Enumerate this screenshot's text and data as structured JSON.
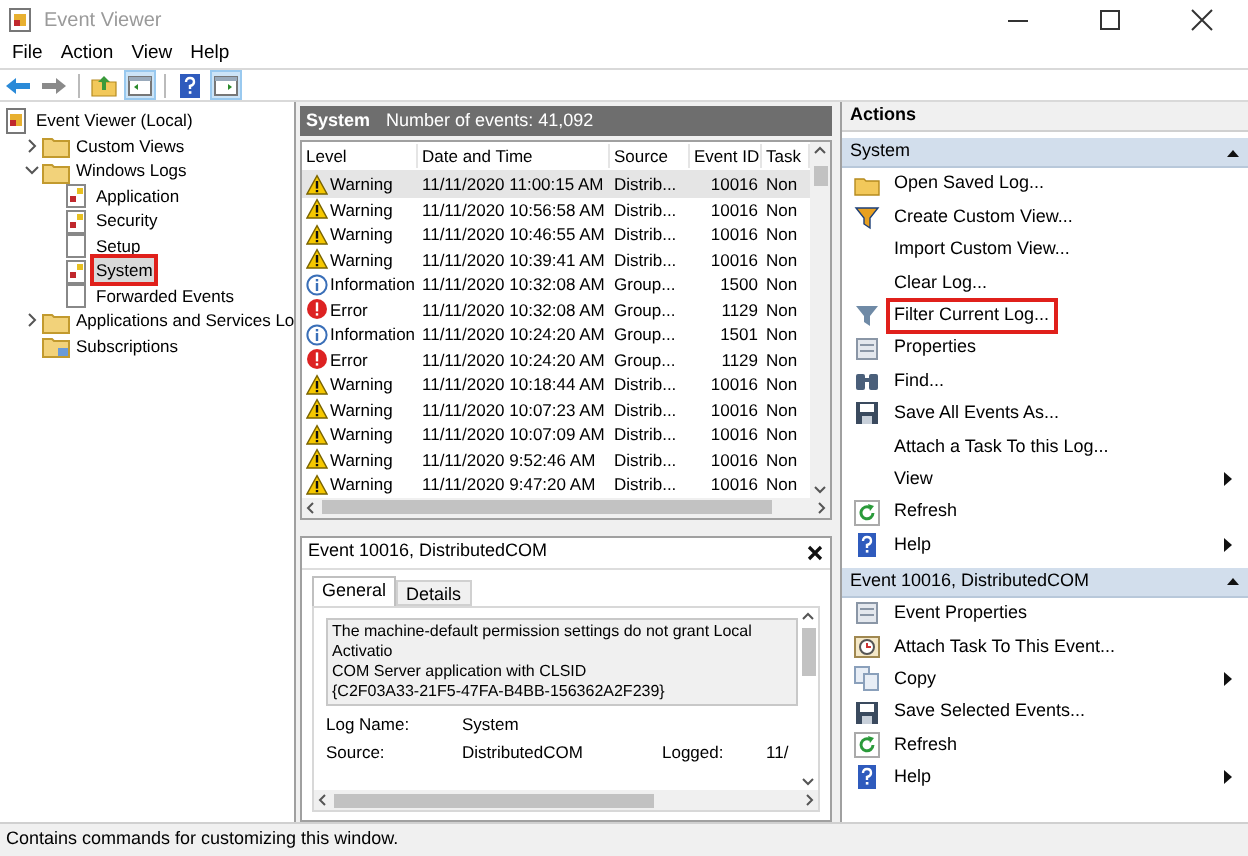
{
  "window": {
    "title": "Event Viewer"
  },
  "menu": [
    "File",
    "Action",
    "View",
    "Help"
  ],
  "toolbar": [
    {
      "kind": "back",
      "pressed": false
    },
    {
      "kind": "forward",
      "pressed": false
    },
    {
      "kind": "up",
      "pressed": false
    },
    {
      "kind": "tree-pane",
      "pressed": true
    },
    {
      "kind": "help",
      "pressed": false
    },
    {
      "kind": "action-pane",
      "pressed": true
    }
  ],
  "tree": [
    {
      "label": "Event Viewer (Local)",
      "kind": "root",
      "selected": false,
      "highlighted": false,
      "children": [
        {
          "label": "Custom Views",
          "kind": "group",
          "expanded": false,
          "selected": false,
          "highlighted": false
        },
        {
          "label": "Windows Logs",
          "kind": "group",
          "expanded": true,
          "selected": false,
          "highlighted": false,
          "children": [
            {
              "label": "Application",
              "kind": "log",
              "selected": false,
              "highlighted": false
            },
            {
              "label": "Security",
              "kind": "log",
              "selected": false,
              "highlighted": false
            },
            {
              "label": "Setup",
              "kind": "blank-log",
              "selected": false,
              "highlighted": false
            },
            {
              "label": "System",
              "kind": "log",
              "selected": true,
              "highlighted": true
            },
            {
              "label": "Forwarded Events",
              "kind": "blank-log",
              "selected": false,
              "highlighted": false
            }
          ]
        },
        {
          "label": "Applications and Services Lo",
          "kind": "group",
          "expanded": false,
          "selected": false,
          "highlighted": false
        },
        {
          "label": "Subscriptions",
          "kind": "subscriptions",
          "selected": false,
          "highlighted": false
        }
      ]
    }
  ],
  "events_panel": {
    "title": "System",
    "count": "Number of events: 41,092",
    "columns": [
      "Level",
      "Date and Time",
      "Source",
      "Event ID",
      "Task"
    ],
    "rows": [
      {
        "kind": "warning",
        "severity": "Warning",
        "date": "11/11/2020 11:00:15 AM",
        "source": "Distrib...",
        "event_id": "10016",
        "task": "Non",
        "selected": true
      },
      {
        "kind": "warning",
        "severity": "Warning",
        "date": "11/11/2020 10:56:58 AM",
        "source": "Distrib...",
        "event_id": "10016",
        "task": "Non",
        "selected": false
      },
      {
        "kind": "warning",
        "severity": "Warning",
        "date": "11/11/2020 10:46:55 AM",
        "source": "Distrib...",
        "event_id": "10016",
        "task": "Non",
        "selected": false
      },
      {
        "kind": "warning",
        "severity": "Warning",
        "date": "11/11/2020 10:39:41 AM",
        "source": "Distrib...",
        "event_id": "10016",
        "task": "Non",
        "selected": false
      },
      {
        "kind": "information",
        "severity": "Information",
        "date": "11/11/2020 10:32:08 AM",
        "source": "Group...",
        "event_id": "1500",
        "task": "Non",
        "selected": false
      },
      {
        "kind": "error",
        "severity": "Error",
        "date": "11/11/2020 10:32:08 AM",
        "source": "Group...",
        "event_id": "1129",
        "task": "Non",
        "selected": false
      },
      {
        "kind": "information",
        "severity": "Information",
        "date": "11/11/2020 10:24:20 AM",
        "source": "Group...",
        "event_id": "1501",
        "task": "Non",
        "selected": false
      },
      {
        "kind": "error",
        "severity": "Error",
        "date": "11/11/2020 10:24:20 AM",
        "source": "Group...",
        "event_id": "1129",
        "task": "Non",
        "selected": false
      },
      {
        "kind": "warning",
        "severity": "Warning",
        "date": "11/11/2020 10:18:44 AM",
        "source": "Distrib...",
        "event_id": "10016",
        "task": "Non",
        "selected": false
      },
      {
        "kind": "warning",
        "severity": "Warning",
        "date": "11/11/2020 10:07:23 AM",
        "source": "Distrib...",
        "event_id": "10016",
        "task": "Non",
        "selected": false
      },
      {
        "kind": "warning",
        "severity": "Warning",
        "date": "11/11/2020 10:07:09 AM",
        "source": "Distrib...",
        "event_id": "10016",
        "task": "Non",
        "selected": false
      },
      {
        "kind": "warning",
        "severity": "Warning",
        "date": "11/11/2020 9:52:46 AM",
        "source": "Distrib...",
        "event_id": "10016",
        "task": "Non",
        "selected": false
      },
      {
        "kind": "warning",
        "severity": "Warning",
        "date": "11/11/2020 9:47:20 AM",
        "source": "Distrib...",
        "event_id": "10016",
        "task": "Non",
        "selected": false
      }
    ]
  },
  "detail": {
    "title": "Event 10016, DistributedCOM",
    "tabs": [
      {
        "label": "General",
        "selected": true
      },
      {
        "label": "Details",
        "selected": false
      }
    ],
    "description": [
      "The machine-default permission settings do not grant Local Activatio",
      "COM Server application with CLSID",
      "{C2F03A33-21F5-47FA-B4BB-156362A2F239}"
    ],
    "fields": [
      {
        "label": "Log Name:",
        "value": "System"
      },
      {
        "label": "Source:",
        "value": "DistributedCOM",
        "extra_label": "Logged:",
        "extra_value": "11/"
      }
    ]
  },
  "actions": {
    "title": "Actions",
    "sections": [
      {
        "title": "System",
        "expanded": true,
        "items": [
          {
            "label": "Open Saved Log...",
            "kind": "open",
            "submenu": false,
            "highlighted": false
          },
          {
            "label": "Create Custom View...",
            "kind": "filter",
            "submenu": false,
            "highlighted": false
          },
          {
            "label": "Import Custom View...",
            "kind": "none",
            "submenu": false,
            "highlighted": false
          },
          {
            "label": "Clear Log...",
            "kind": "none",
            "submenu": false,
            "highlighted": false
          },
          {
            "label": "Filter Current Log...",
            "kind": "filter-gray",
            "submenu": false,
            "highlighted": true
          },
          {
            "label": "Properties",
            "kind": "properties",
            "submenu": false,
            "highlighted": false
          },
          {
            "label": "Find...",
            "kind": "find",
            "submenu": false,
            "highlighted": false
          },
          {
            "label": "Save All Events As...",
            "kind": "save",
            "submenu": false,
            "highlighted": false
          },
          {
            "label": "Attach a Task To this Log...",
            "kind": "none",
            "submenu": false,
            "highlighted": false
          },
          {
            "label": "View",
            "kind": "none",
            "submenu": true,
            "highlighted": false
          },
          {
            "label": "Refresh",
            "kind": "refresh",
            "submenu": false,
            "highlighted": false
          },
          {
            "label": "Help",
            "kind": "help",
            "submenu": true,
            "highlighted": false
          }
        ]
      },
      {
        "title": "Event 10016, DistributedCOM",
        "expanded": true,
        "items": [
          {
            "label": "Event Properties",
            "kind": "properties",
            "submenu": false,
            "highlighted": false
          },
          {
            "label": "Attach Task To This Event...",
            "kind": "task",
            "submenu": false,
            "highlighted": false
          },
          {
            "label": "Copy",
            "kind": "copy",
            "submenu": true,
            "highlighted": false
          },
          {
            "label": "Save Selected Events...",
            "kind": "save",
            "submenu": false,
            "highlighted": false
          },
          {
            "label": "Refresh",
            "kind": "refresh",
            "submenu": false,
            "highlighted": false
          },
          {
            "label": "Help",
            "kind": "help",
            "submenu": true,
            "highlighted": false
          }
        ]
      }
    ]
  },
  "status_bar": "Contains commands for customizing this window."
}
